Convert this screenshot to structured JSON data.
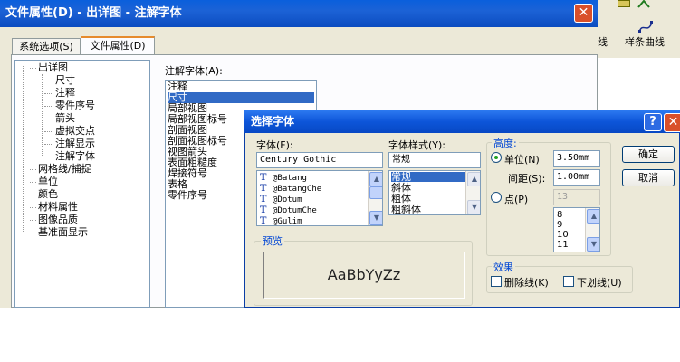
{
  "back_window": {
    "title": "文件属性(D) - 出详图 - 注解字体",
    "tabs": [
      {
        "label": "系统选项(S)"
      },
      {
        "label": "文件属性(D)"
      }
    ],
    "tree": [
      {
        "label": "出详图",
        "level": 1
      },
      {
        "label": "尺寸",
        "level": 2
      },
      {
        "label": "注释",
        "level": 2
      },
      {
        "label": "零件序号",
        "level": 2
      },
      {
        "label": "箭头",
        "level": 2
      },
      {
        "label": "虚拟交点",
        "level": 2
      },
      {
        "label": "注解显示",
        "level": 2
      },
      {
        "label": "注解字体",
        "level": 2
      },
      {
        "label": "网格线/捕捉",
        "level": 1
      },
      {
        "label": "单位",
        "level": 1
      },
      {
        "label": "颜色",
        "level": 1
      },
      {
        "label": "材料属性",
        "level": 1
      },
      {
        "label": "图像品质",
        "level": 1
      },
      {
        "label": "基准面显示",
        "level": 1
      }
    ],
    "annotation_font_label": "注解字体(A):",
    "annotation_items": [
      {
        "label": "注释",
        "selected": false
      },
      {
        "label": "尺寸",
        "selected": true
      },
      {
        "label": "局部视图",
        "selected": false
      },
      {
        "label": "局部视图标号",
        "selected": false
      },
      {
        "label": "剖面视图",
        "selected": false
      },
      {
        "label": "剖面视图标号",
        "selected": false
      },
      {
        "label": "视图箭头",
        "selected": false
      },
      {
        "label": "表面粗糙度",
        "selected": false
      },
      {
        "label": "焊接符号",
        "selected": false
      },
      {
        "label": "表格",
        "selected": false
      },
      {
        "label": "零件序号",
        "selected": false
      }
    ]
  },
  "toolbar": {
    "line_label": "线",
    "spline_label": "样条曲线"
  },
  "font_dialog": {
    "title": "选择字体",
    "help_label": "?",
    "font": {
      "label": "字体(F):",
      "value": "Century Gothic",
      "options": [
        "@Batang",
        "@BatangChe",
        "@Dotum",
        "@DotumChe",
        "@Gulim"
      ]
    },
    "style": {
      "label": "字体样式(Y):",
      "value": "常规",
      "options": [
        {
          "label": "常规",
          "selected": true
        },
        {
          "label": "斜体",
          "selected": false
        },
        {
          "label": "粗体",
          "selected": false
        },
        {
          "label": "粗斜体",
          "selected": false
        }
      ]
    },
    "height": {
      "group_label": "高度:",
      "unit_label": "单位(N)",
      "unit_value": "3.50mm",
      "spacing_label": "间距(S):",
      "spacing_value": "1.00mm",
      "point_label": "点(P)",
      "point_value": "13",
      "point_sizes": [
        "8",
        "9",
        "10",
        "11"
      ],
      "selected_mode": "unit"
    },
    "ok_label": "确定",
    "cancel_label": "取消",
    "preview_label": "预览",
    "preview_text": "AaBbYyZz",
    "effects": {
      "group_label": "效果",
      "strikeout_label": "删除线(K)",
      "underline_label": "下划线(U)",
      "strikeout_checked": false,
      "underline_checked": false
    }
  }
}
